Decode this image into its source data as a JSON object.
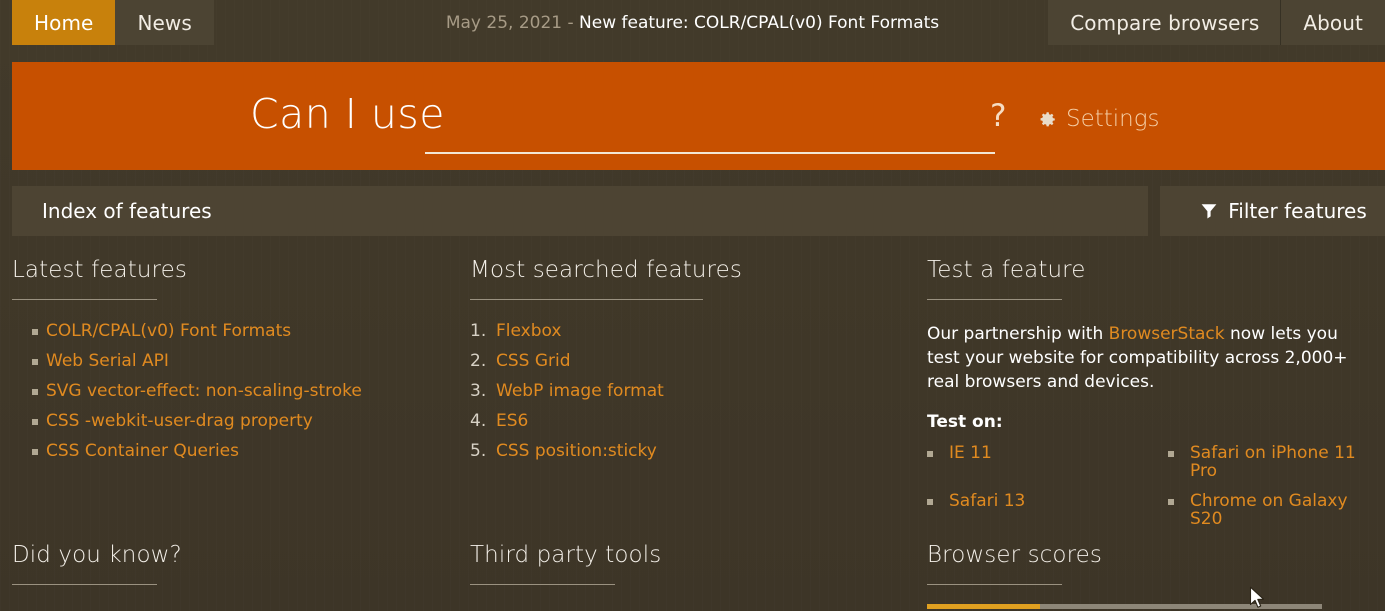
{
  "nav": {
    "left_tabs": [
      {
        "label": "Home",
        "active": true
      },
      {
        "label": "News",
        "active": false
      }
    ],
    "right_tabs": [
      {
        "label": "Compare browsers"
      },
      {
        "label": "About"
      }
    ],
    "news": {
      "date": "May 25, 2021",
      "separator": "-",
      "title": "New feature: COLR/CPAL(v0) Font Formats"
    }
  },
  "header": {
    "logo": "Can I use",
    "search_value": "",
    "search_placeholder": "",
    "help_icon": "question-mark-icon",
    "settings_icon": "gear-icon",
    "settings_label": "Settings",
    "accent_color": "#c75000"
  },
  "index_bar": {
    "label": "Index of features",
    "filter_icon": "funnel-icon",
    "filter_label": "Filter features"
  },
  "sections": {
    "latest_features": {
      "title": "Latest features",
      "items": [
        "COLR/CPAL(v0) Font Formats",
        "Web Serial API",
        "SVG vector-effect: non-scaling-stroke",
        "CSS -webkit-user-drag property",
        "CSS Container Queries"
      ]
    },
    "most_searched": {
      "title": "Most searched features",
      "items": [
        "Flexbox",
        "CSS Grid",
        "WebP image format",
        "ES6",
        "CSS position:sticky"
      ]
    },
    "test_a_feature": {
      "title": "Test a feature",
      "paragraph_before": "Our partnership with ",
      "partner_link": "BrowserStack",
      "paragraph_after": " now lets you test your website for compatibility across 2,000+ real browsers and devices.",
      "test_on_label": "Test on:",
      "targets": [
        "IE 11",
        "Safari on iPhone 11 Pro",
        "Safari 13",
        "Chrome on Galaxy S20"
      ]
    },
    "did_you_know": {
      "title": "Did you know?"
    },
    "third_party_tools": {
      "title": "Third party tools"
    },
    "browser_scores": {
      "title": "Browser scores"
    }
  },
  "colors": {
    "page_background": "#3f3728",
    "panel": "#4d4433",
    "accent_orange": "#c75000",
    "link_orange": "#e08a20",
    "active_tab": "#c8810c"
  }
}
